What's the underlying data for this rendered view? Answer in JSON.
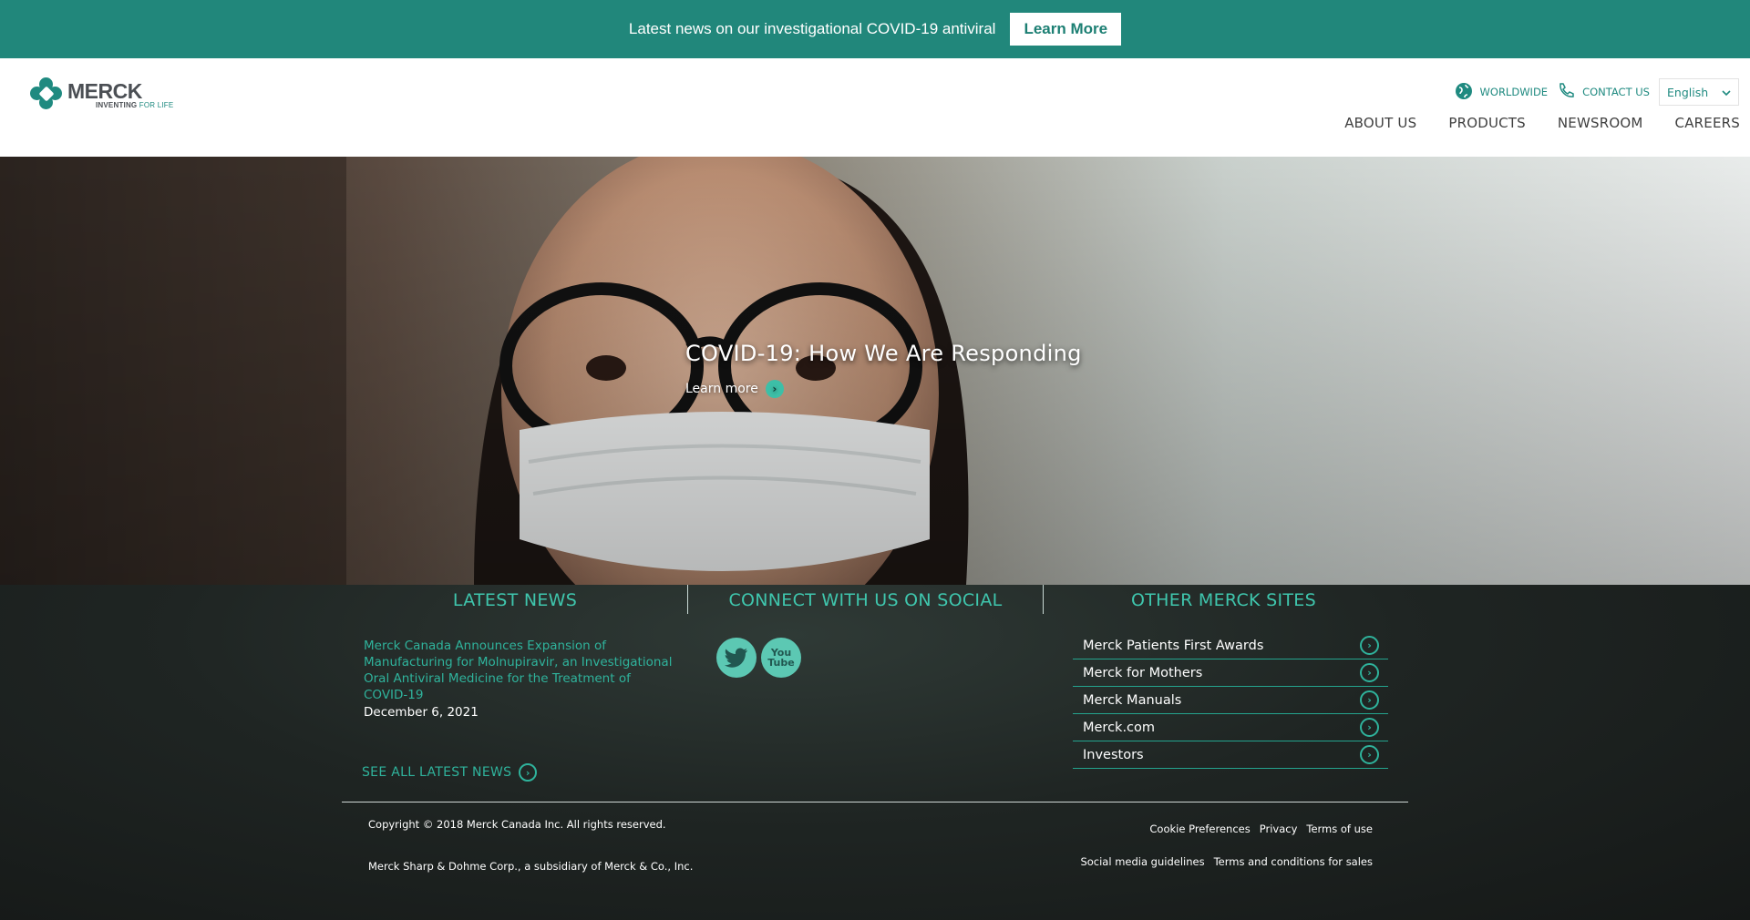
{
  "banner": {
    "text": "Latest news on our investigational COVID-19 antiviral",
    "button": "Learn More"
  },
  "header": {
    "logo_word": "MERCK",
    "logo_tag_a": "INVENTING",
    "logo_tag_b": "FOR LIFE",
    "utility": {
      "worldwide": "WORLDWIDE",
      "contact": "CONTACT US",
      "language": "English"
    },
    "nav": [
      "ABOUT US",
      "PRODUCTS",
      "NEWSROOM",
      "CAREERS"
    ]
  },
  "hero": {
    "title": "COVID-19: How We Are Responding",
    "link": "Learn more"
  },
  "latest_news": {
    "heading": "LATEST NEWS",
    "item_title": "Merck Canada Announces Expansion of Manufacturing for Molnupiravir, an Investigational Oral Antiviral Medicine for the Treatment of COVID-19",
    "item_date": "December 6, 2021",
    "see_all": "SEE ALL LATEST NEWS"
  },
  "social": {
    "heading": "CONNECT WITH US ON SOCIAL",
    "youtube_a": "You",
    "youtube_b": "Tube"
  },
  "other_sites": {
    "heading": "OTHER MERCK SITES",
    "items": [
      "Merck Patients First Awards",
      "Merck for Mothers",
      "Merck Manuals",
      "Merck.com",
      "Investors"
    ]
  },
  "footer": {
    "copyright": "Copyright © 2018 Merck Canada Inc. All rights reserved.",
    "subsidiary": "Merck Sharp & Dohme Corp., a subsidiary of Merck & Co., Inc.",
    "links_row1": [
      "Cookie Preferences",
      "Privacy",
      "Terms of use"
    ],
    "links_row2": [
      "Social media guidelines",
      "Terms and conditions for sales"
    ]
  },
  "colors": {
    "brand_teal": "#21877b",
    "accent_teal": "#3fc6ad",
    "dark_bg": "#1b1d1c"
  }
}
